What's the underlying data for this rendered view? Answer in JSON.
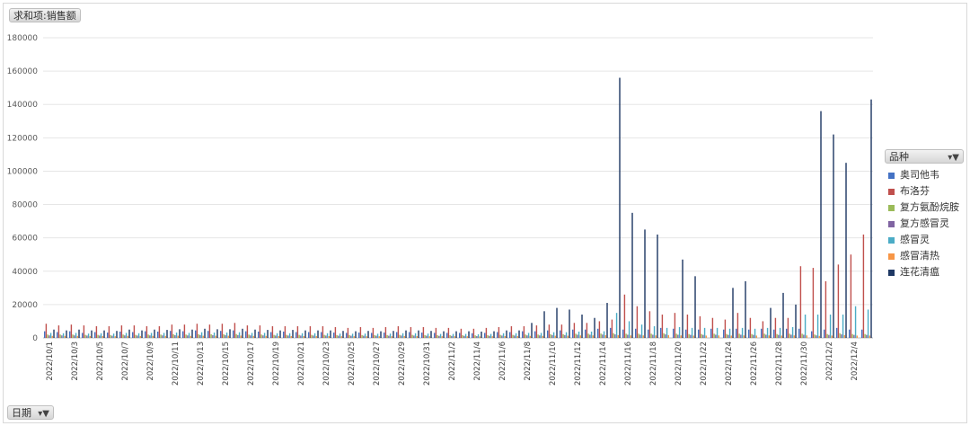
{
  "value_field": {
    "label": "求和项:销售额"
  },
  "axis_field": {
    "label": "日期",
    "icon": "filter-icon"
  },
  "legend_field": {
    "label": "品种",
    "icon": "filter-icon"
  },
  "chart_data": {
    "type": "bar",
    "title": "",
    "xlabel": "",
    "ylabel": "",
    "ylim": [
      0,
      180000
    ],
    "yticks": [
      0,
      20000,
      40000,
      60000,
      80000,
      100000,
      120000,
      140000,
      160000,
      180000
    ],
    "grid": true,
    "legend_position": "right",
    "categories": [
      "2022/10/1",
      "2022/10/2",
      "2022/10/3",
      "2022/10/4",
      "2022/10/5",
      "2022/10/6",
      "2022/10/7",
      "2022/10/8",
      "2022/10/9",
      "2022/10/10",
      "2022/10/11",
      "2022/10/12",
      "2022/10/13",
      "2022/10/14",
      "2022/10/15",
      "2022/10/16",
      "2022/10/17",
      "2022/10/18",
      "2022/10/19",
      "2022/10/20",
      "2022/10/21",
      "2022/10/22",
      "2022/10/23",
      "2022/10/24",
      "2022/10/25",
      "2022/10/26",
      "2022/10/27",
      "2022/10/28",
      "2022/10/29",
      "2022/10/30",
      "2022/10/31",
      "2022/11/1",
      "2022/11/2",
      "2022/11/3",
      "2022/11/4",
      "2022/11/5",
      "2022/11/6",
      "2022/11/7",
      "2022/11/8",
      "2022/11/9",
      "2022/11/10",
      "2022/11/11",
      "2022/11/12",
      "2022/11/13",
      "2022/11/14",
      "2022/11/15",
      "2022/11/16",
      "2022/11/17",
      "2022/11/18",
      "2022/11/19",
      "2022/11/20",
      "2022/11/21",
      "2022/11/22",
      "2022/11/23",
      "2022/11/24",
      "2022/11/25",
      "2022/11/26",
      "2022/11/27",
      "2022/11/28",
      "2022/11/29",
      "2022/11/30",
      "2022/12/1",
      "2022/12/2",
      "2022/12/3",
      "2022/12/4",
      "2022/12/5"
    ],
    "tick_labels_every": 2,
    "series": [
      {
        "name": "奥司他韦",
        "color": "#4472c4",
        "values": [
          4000,
          3500,
          4000,
          3000,
          3500,
          3200,
          3800,
          3500,
          4000,
          3800,
          4200,
          4000,
          4500,
          4200,
          4200,
          4500,
          4000,
          3800,
          3500,
          3800,
          3500,
          3500,
          3500,
          3200,
          3000,
          3200,
          3000,
          3200,
          3500,
          3500,
          3200,
          3000,
          3000,
          3000,
          2800,
          3000,
          3500,
          3500,
          4000,
          4000,
          4500,
          4500,
          5000,
          5000,
          5500,
          6000,
          5000,
          5500,
          5000,
          6000,
          5500,
          5000,
          5000,
          5500,
          5000,
          5500,
          5000,
          5500,
          5000,
          5500,
          5500,
          4000,
          5000,
          6000,
          5000,
          5000
        ]
      },
      {
        "name": "布洛芬",
        "color": "#c0504d",
        "values": [
          8500,
          7500,
          8000,
          7500,
          7000,
          7000,
          7500,
          7500,
          7000,
          7000,
          8000,
          8000,
          8500,
          8000,
          8500,
          9000,
          7500,
          7500,
          7000,
          7000,
          7000,
          7000,
          7000,
          6500,
          6000,
          6500,
          6000,
          6500,
          7000,
          6500,
          6500,
          6000,
          6000,
          5500,
          5500,
          6000,
          6500,
          7000,
          7000,
          7500,
          8000,
          8000,
          9000,
          9000,
          10000,
          11000,
          26000,
          19000,
          16000,
          14000,
          15000,
          14000,
          13000,
          12000,
          11000,
          15000,
          12000,
          10000,
          12000,
          12000,
          43000,
          42000,
          34000,
          44000,
          50000,
          62000
        ]
      },
      {
        "name": "复方氨酚烷胺",
        "color": "#9bbb59",
        "values": [
          2000,
          2000,
          2000,
          1800,
          1800,
          1700,
          2000,
          1800,
          2000,
          2000,
          2200,
          2000,
          2200,
          2200,
          2200,
          2300,
          2000,
          2000,
          1800,
          1800,
          1800,
          1800,
          1800,
          1700,
          1700,
          1700,
          1700,
          1700,
          1800,
          1800,
          1700,
          1600,
          1600,
          1600,
          1500,
          1600,
          1800,
          1800,
          2000,
          2000,
          2200,
          2200,
          2500,
          2500,
          2600,
          2800,
          2500,
          2500,
          2500,
          2800,
          2500,
          2300,
          2300,
          2500,
          2300,
          2500,
          2300,
          2500,
          2300,
          2500,
          2500,
          2000,
          2300,
          2800,
          2300,
          2300
        ]
      },
      {
        "name": "复方感冒灵",
        "color": "#8064a2",
        "values": [
          1500,
          1500,
          1500,
          1400,
          1400,
          1300,
          1500,
          1400,
          1500,
          1500,
          1600,
          1500,
          1700,
          1600,
          1600,
          1700,
          1500,
          1500,
          1400,
          1400,
          1400,
          1400,
          1400,
          1300,
          1300,
          1300,
          1300,
          1300,
          1400,
          1400,
          1300,
          1200,
          1200,
          1200,
          1100,
          1200,
          1400,
          1400,
          1500,
          1500,
          1700,
          1700,
          1900,
          1900,
          2000,
          2100,
          1900,
          1900,
          1900,
          2100,
          1900,
          1800,
          1800,
          1900,
          1800,
          1900,
          1800,
          1900,
          1800,
          1900,
          1900,
          1500,
          1800,
          2100,
          1800,
          1800
        ]
      },
      {
        "name": "感冒灵",
        "color": "#4bacc6",
        "values": [
          3000,
          2800,
          3000,
          2600,
          2800,
          2600,
          3000,
          2800,
          3000,
          3000,
          3200,
          3000,
          3400,
          3200,
          3200,
          3400,
          3000,
          3000,
          2800,
          2800,
          2800,
          2800,
          2800,
          2600,
          2500,
          2600,
          2500,
          2600,
          2800,
          2800,
          2600,
          2400,
          2400,
          2400,
          2200,
          2400,
          2800,
          2800,
          3000,
          3000,
          3400,
          3400,
          3800,
          3800,
          4000,
          15000,
          10000,
          8000,
          7000,
          6000,
          6500,
          6000,
          6000,
          6000,
          5500,
          6000,
          5500,
          6000,
          6000,
          6500,
          14000,
          14000,
          14000,
          14000,
          19000,
          17000
        ]
      },
      {
        "name": "感冒清热",
        "color": "#f79646",
        "values": [
          1200,
          1200,
          1200,
          1100,
          1100,
          1000,
          1200,
          1100,
          1200,
          1200,
          1300,
          1200,
          1300,
          1300,
          1300,
          1400,
          1200,
          1200,
          1100,
          1100,
          1100,
          1100,
          1100,
          1000,
          1000,
          1000,
          1000,
          1000,
          1100,
          1100,
          1000,
          1000,
          1000,
          1000,
          900,
          1000,
          1100,
          1100,
          1200,
          1200,
          1300,
          1300,
          1500,
          1500,
          1600,
          1700,
          1500,
          1500,
          1500,
          1700,
          1500,
          1400,
          1400,
          1500,
          1400,
          1500,
          1400,
          1500,
          1400,
          1500,
          1500,
          1200,
          1400,
          1700,
          1400,
          1400
        ]
      },
      {
        "name": "连花清瘟",
        "color": "#1f3864",
        "values": [
          5000,
          4500,
          5000,
          4500,
          4500,
          4200,
          5000,
          4500,
          5000,
          4800,
          5200,
          5000,
          5500,
          5200,
          5200,
          5500,
          5000,
          4800,
          4500,
          4800,
          4500,
          4500,
          4500,
          4200,
          4000,
          4200,
          4000,
          4200,
          4500,
          4500,
          4200,
          4000,
          4000,
          4000,
          3800,
          4000,
          4500,
          4500,
          9000,
          16000,
          18000,
          17000,
          14000,
          12000,
          21000,
          156000,
          75000,
          65000,
          62000,
          0,
          47000,
          37000,
          0,
          0,
          30000,
          34000,
          0,
          18000,
          27000,
          20000,
          0,
          136000,
          122000,
          105000,
          0,
          143000
        ]
      }
    ]
  }
}
